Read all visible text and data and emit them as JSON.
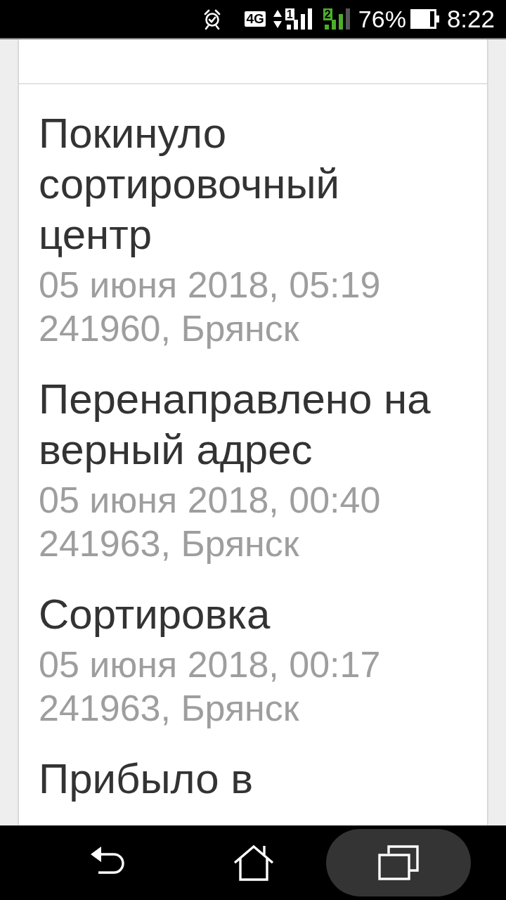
{
  "status_bar": {
    "network": "4G",
    "sim_1": "1",
    "sim_2": "2",
    "battery": "76%",
    "time": "8:22"
  },
  "events": [
    {
      "title": "Покинуло сортировочный центр",
      "date": "05 июня 2018, 05:19",
      "location": "241960, Брянск"
    },
    {
      "title": "Перенаправлено на верный адрес",
      "date": "05 июня 2018, 00:40",
      "location": "241963, Брянск"
    },
    {
      "title": "Сортировка",
      "date": "05 июня 2018, 00:17",
      "location": "241963, Брянск"
    },
    {
      "title": "Прибыло в"
    }
  ],
  "nav_bar": [
    {
      "kind": "back",
      "pressed": false
    },
    {
      "kind": "home",
      "pressed": false
    },
    {
      "kind": "recents",
      "pressed": true
    }
  ]
}
